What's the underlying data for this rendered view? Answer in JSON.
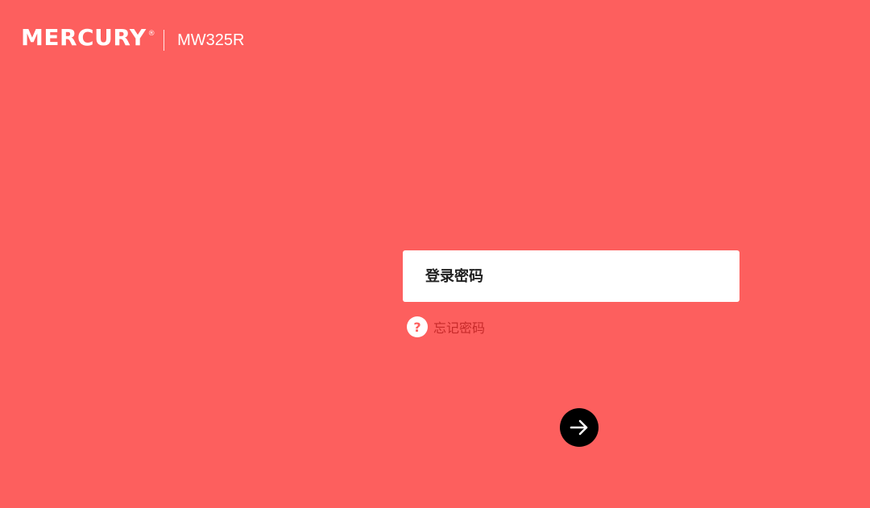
{
  "header": {
    "brand": "MERCURY",
    "registered_mark": "®",
    "model": "MW325R"
  },
  "login": {
    "password_placeholder": "登录密码",
    "forgot_password_label": "忘记密码",
    "help_glyph": "?"
  },
  "icons": {
    "help": "question-mark-icon",
    "submit": "arrow-right-icon"
  },
  "colors": {
    "background": "#fd5f5e",
    "forgot_text": "#c62a2a",
    "button": "#000000"
  }
}
